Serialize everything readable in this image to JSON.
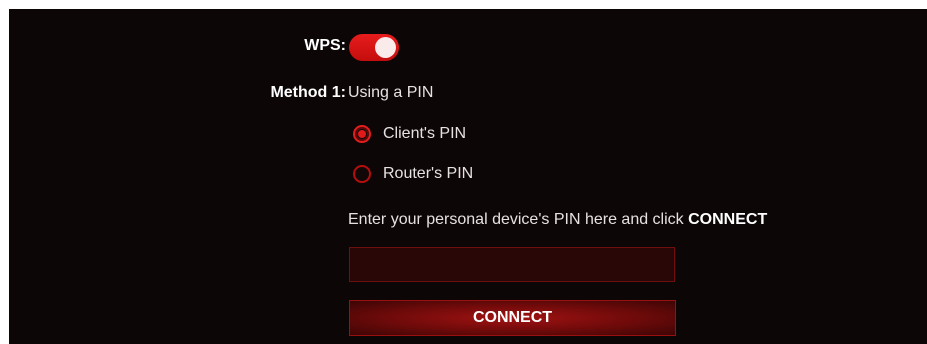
{
  "wps": {
    "label": "WPS:",
    "enabled": true
  },
  "method1": {
    "label": "Method 1:",
    "value": "Using a PIN"
  },
  "pin_source": {
    "options": [
      {
        "label": "Client's PIN",
        "selected": true
      },
      {
        "label": "Router's PIN",
        "selected": false
      }
    ]
  },
  "hint": {
    "text": "Enter your personal device's PIN here and click ",
    "emphasis": "CONNECT"
  },
  "pin_input": {
    "value": "",
    "placeholder": ""
  },
  "connect_button": {
    "label": "CONNECT"
  },
  "colors": {
    "accent": "#e01a1a",
    "background": "#0d0606"
  }
}
